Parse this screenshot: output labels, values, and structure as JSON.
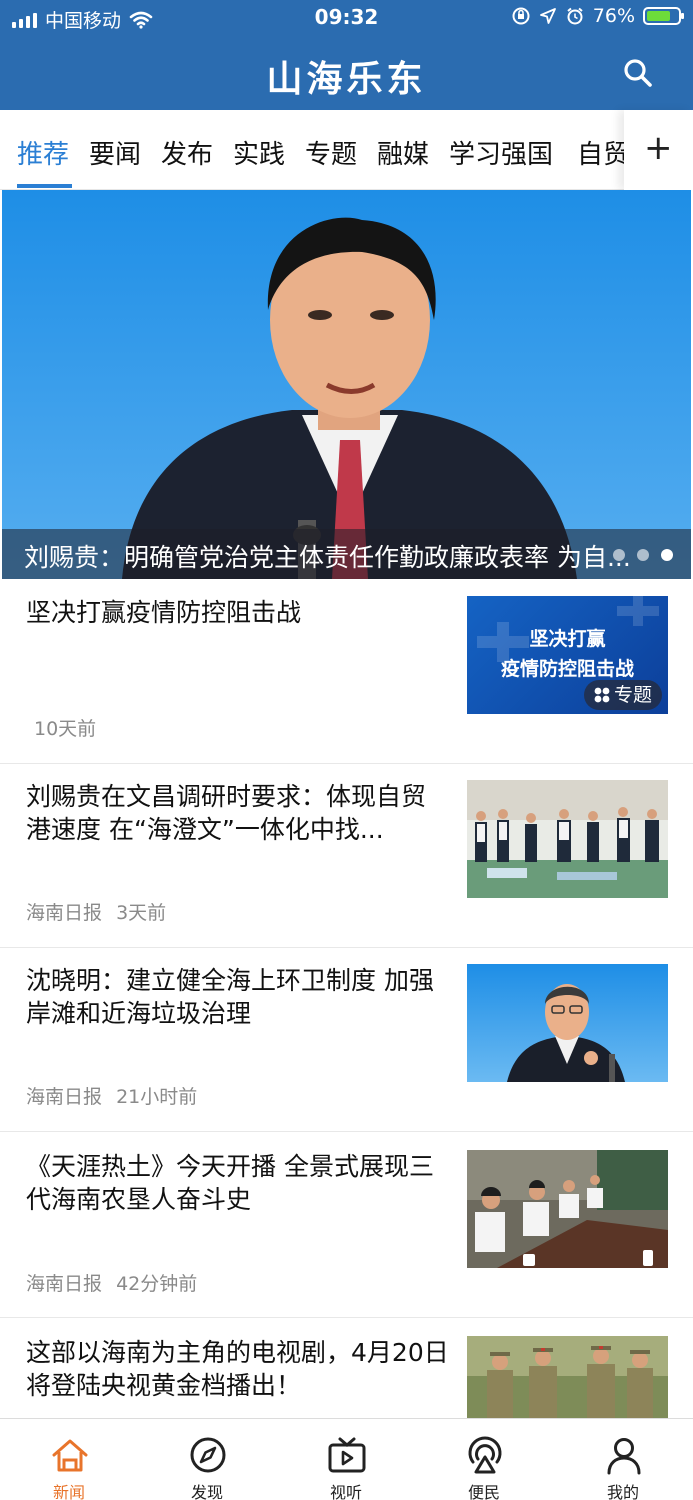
{
  "status_bar": {
    "carrier": "中国移动",
    "time": "09:32",
    "battery_percent": "76%",
    "battery_level": 0.76
  },
  "app": {
    "title": "山海乐东"
  },
  "tabs": [
    {
      "label": "推荐",
      "active": true
    },
    {
      "label": "要闻"
    },
    {
      "label": "发布"
    },
    {
      "label": "实践"
    },
    {
      "label": "专题"
    },
    {
      "label": "融媒"
    },
    {
      "label": "学习强国"
    },
    {
      "label": "自贸"
    }
  ],
  "add_tab_label": "+",
  "hero": {
    "caption": "刘赐贵：明确管党治党主体责任作勤政廉政表率 为自..."
  },
  "news": [
    {
      "title": "坚决打赢疫情防控阻击战",
      "source": "",
      "time": "10天前",
      "thumb_text_line1": "坚决打赢",
      "thumb_text_line2": "疫情防控阻击战",
      "thumb_badge": "专题"
    },
    {
      "title": "刘赐贵在文昌调研时要求：体现自贸港速度 在“海澄文”一体化中找...",
      "source": "海南日报",
      "time": "3天前"
    },
    {
      "title": "沈晓明：建立健全海上环卫制度 加强岸滩和近海垃圾治理",
      "source": "海南日报",
      "time": "21小时前"
    },
    {
      "title": "《天涯热土》今天开播 全景式展现三代海南农垦人奋斗史",
      "source": "海南日报",
      "time": "42分钟前"
    },
    {
      "title": "这部以海南为主角的电视剧，4月20日将登陆央视黄金档播出！",
      "source": "",
      "time": ""
    }
  ],
  "bottom_nav": [
    {
      "label": "新闻",
      "icon": "home-icon",
      "active": true
    },
    {
      "label": "发现",
      "icon": "compass-icon"
    },
    {
      "label": "视听",
      "icon": "tv-icon"
    },
    {
      "label": "便民",
      "icon": "broadcast-icon"
    },
    {
      "label": "我的",
      "icon": "user-icon"
    }
  ],
  "colors": {
    "brand_blue": "#2b6cb0",
    "active_tab": "#2b7fd4",
    "active_nav": "#e8742b"
  }
}
